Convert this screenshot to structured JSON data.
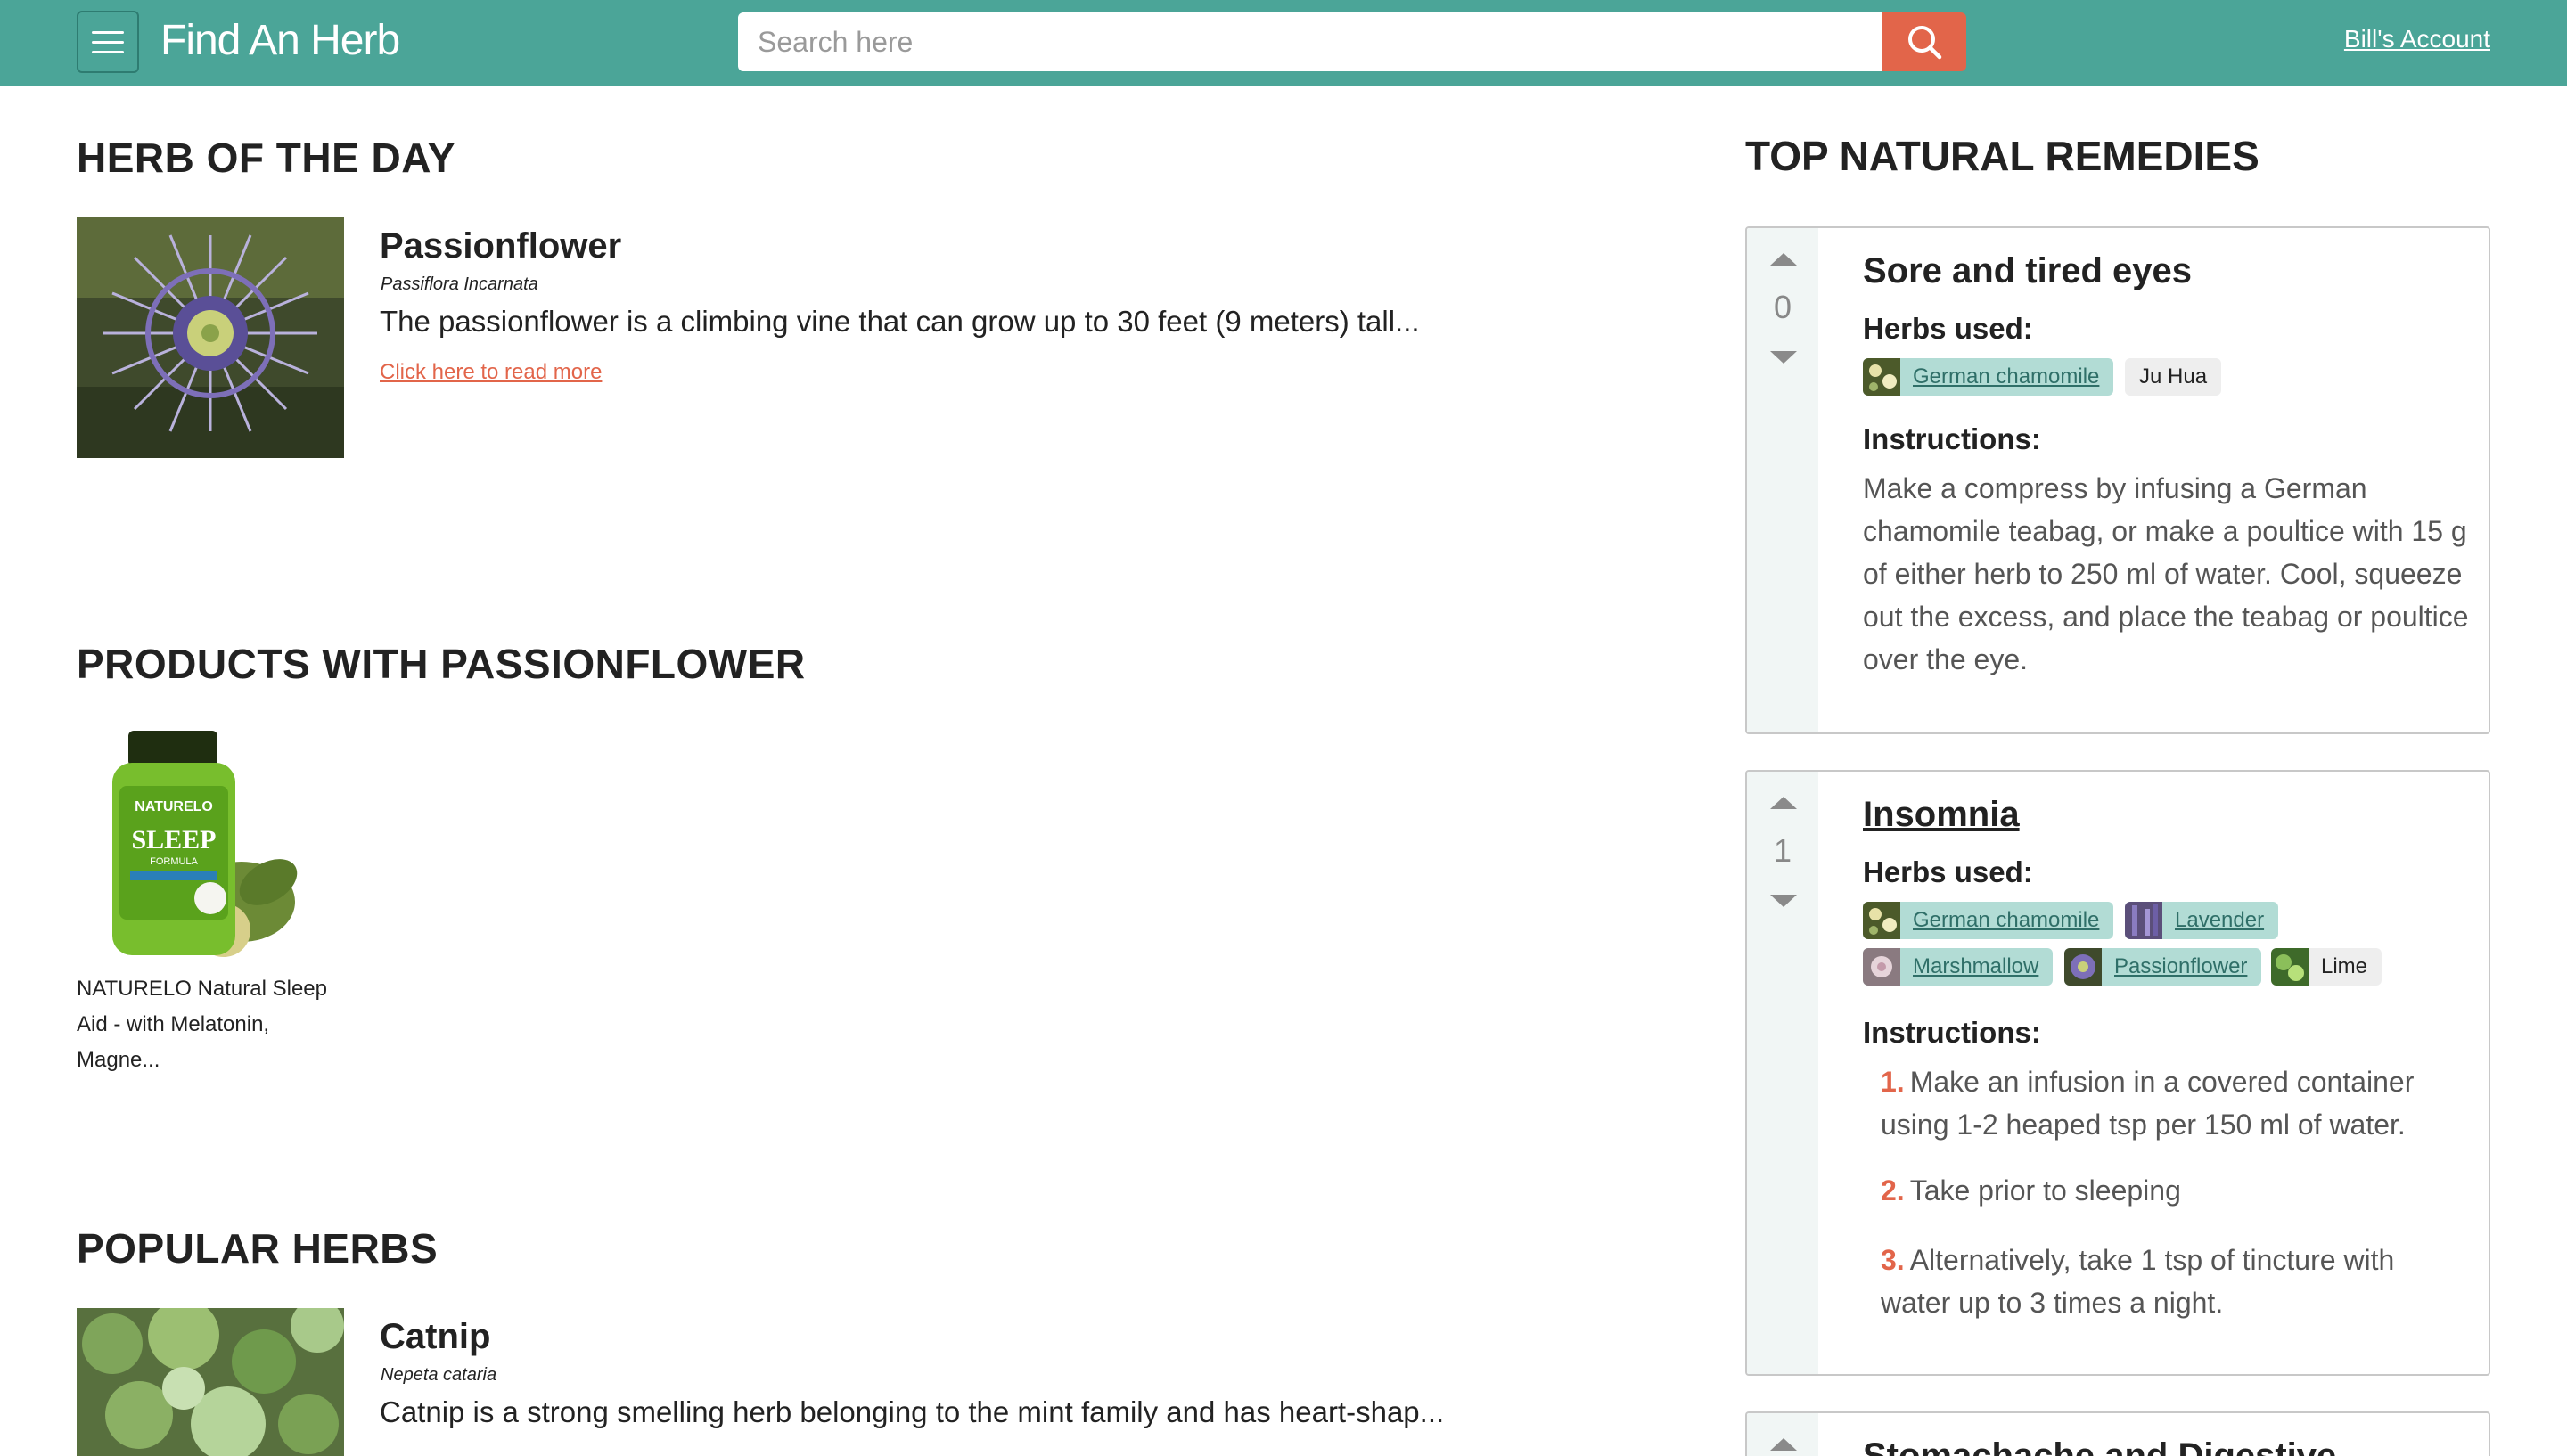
{
  "header": {
    "app_title": "Find An Herb",
    "search_placeholder": "Search here",
    "account_link": "Bill's Account"
  },
  "herb_of_the_day": {
    "section_title": "HERB OF THE DAY",
    "name": "Passionflower",
    "latin": "Passiflora Incarnata",
    "description": "The passionflower is a climbing vine that can grow up to 30 feet (9 meters) tall...",
    "read_more": "Click here to read more"
  },
  "products": {
    "section_title": "PRODUCTS WITH PASSIONFLOWER",
    "items": [
      {
        "name": "NATURELO Natural Sleep Aid - with Melatonin, Magne...",
        "label_brand": "NATURELO",
        "label_word": "SLEEP",
        "label_sub": "FORMULA"
      }
    ]
  },
  "popular_herbs": {
    "section_title": "POPULAR HERBS",
    "items": [
      {
        "name": "Catnip",
        "latin": "Nepeta cataria",
        "description": "Catnip is a strong smelling herb belonging to the mint family and has heart-shap..."
      }
    ]
  },
  "remedies": {
    "section_title": "TOP NATURAL REMEDIES",
    "herbs_used_label": "Herbs used:",
    "instructions_label": "Instructions:",
    "items": [
      {
        "title": "Sore and tired eyes",
        "votes": "0",
        "herbs": [
          {
            "label": "German chamomile",
            "linked": true
          },
          {
            "label": "Ju Hua",
            "linked": false
          }
        ],
        "instructions": "Make a compress by infusing a German chamomile teabag, or make a poultice with 15 g of either herb to 250 ml of water. Cool, squeeze out the excess, and place the teabag or poultice over the eye."
      },
      {
        "title": "Insomnia",
        "votes": "1",
        "herbs": [
          {
            "label": "German chamomile",
            "linked": true
          },
          {
            "label": "Lavender",
            "linked": true
          },
          {
            "label": "Marshmallow",
            "linked": true
          },
          {
            "label": "Passionflower",
            "linked": true
          },
          {
            "label": "Lime",
            "linked": false
          }
        ],
        "steps": [
          {
            "num": "1.",
            "text": "Make an infusion in a covered container using 1-2 heaped tsp per 150 ml of water."
          },
          {
            "num": "2.",
            "text": "Take prior to sleeping"
          },
          {
            "num": "3.",
            "text": "Alternatively, take 1 tsp of tincture with water up to 3 times a night."
          }
        ]
      },
      {
        "title": "Stomachache and Digestive Infections",
        "votes": ""
      }
    ]
  },
  "colors": {
    "header_bg": "#4ba598",
    "accent": "#e2654a",
    "chip_linked": "#b2dcd5",
    "chip_plain": "#eeeeee"
  }
}
